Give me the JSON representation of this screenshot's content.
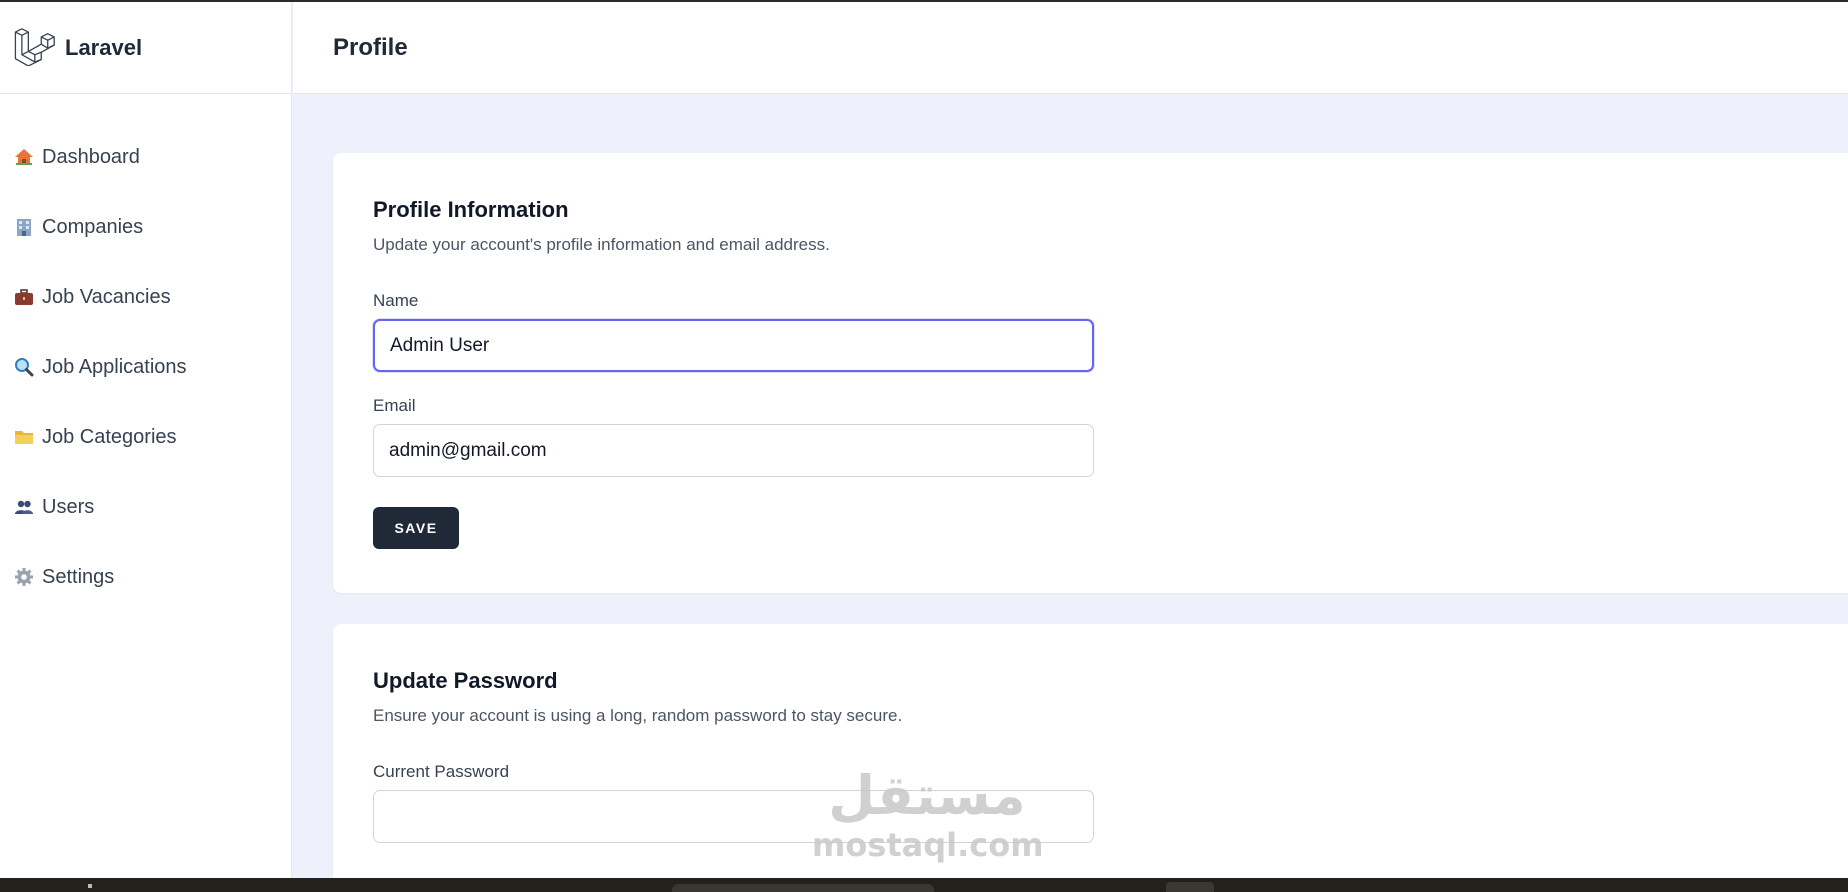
{
  "brand": {
    "name": "Laravel"
  },
  "sidebar": {
    "items": [
      {
        "label": "Dashboard",
        "icon": "house-icon"
      },
      {
        "label": "Companies",
        "icon": "office-building-icon"
      },
      {
        "label": "Job Vacancies",
        "icon": "briefcase-icon"
      },
      {
        "label": "Job Applications",
        "icon": "magnifier-icon"
      },
      {
        "label": "Job Categories",
        "icon": "folder-icon"
      },
      {
        "label": "Users",
        "icon": "users-icon"
      },
      {
        "label": "Settings",
        "icon": "gear-icon"
      }
    ]
  },
  "header": {
    "title": "Profile"
  },
  "profile_info": {
    "title": "Profile Information",
    "subtitle": "Update your account's profile information and email address.",
    "name_label": "Name",
    "name_value": "Admin User",
    "email_label": "Email",
    "email_value": "admin@gmail.com",
    "save_label": "SAVE"
  },
  "update_password": {
    "title": "Update Password",
    "subtitle": "Ensure your account is using a long, random password to stay secure.",
    "current_password_label": "Current Password",
    "current_password_value": ""
  },
  "watermark": {
    "arabic": "مستقل",
    "latin": "mostaql.com"
  },
  "colors": {
    "page_bg": "#eef1fb",
    "primary_button": "#1f2937",
    "focus_ring": "#6366f1",
    "laravel_logo": "#374151"
  }
}
